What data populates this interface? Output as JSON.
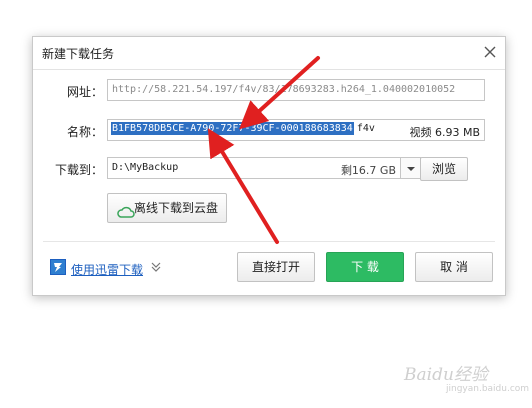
{
  "dialog": {
    "title": "新建下载任务",
    "url_label": "网址：",
    "url_value": "http://58.221.54.197/f4v/83/178693283.h264_1.040002010052",
    "name_label": "名称：",
    "name_selected": "B1FB578DB5CE-A790-72F7-39CF-000188683834",
    "name_ext": "f4v",
    "name_type": "视频",
    "name_size": "6.93 MB",
    "path_label": "下载到：",
    "path_value": "D:\\MyBackup",
    "path_free": "剩16.7 GB",
    "browse_label": "浏览",
    "cloud_label": "离线下载到云盘",
    "thunder_label": "使用迅雷下载",
    "open_label": "直接打开",
    "download_label": "下 载",
    "cancel_label": "取 消"
  },
  "colors": {
    "accent_green": "#2dbb63",
    "selection_blue": "#2d6fc2",
    "link_blue": "#1d5fbf",
    "annotation_red": "#e02020"
  },
  "icons": [
    "close-icon",
    "chevron-down-icon",
    "cloud-icon",
    "thunder-icon",
    "double-chevron-down-icon"
  ],
  "watermark": {
    "text": "Baidu经验",
    "sub": "jingyan.baidu.com"
  }
}
